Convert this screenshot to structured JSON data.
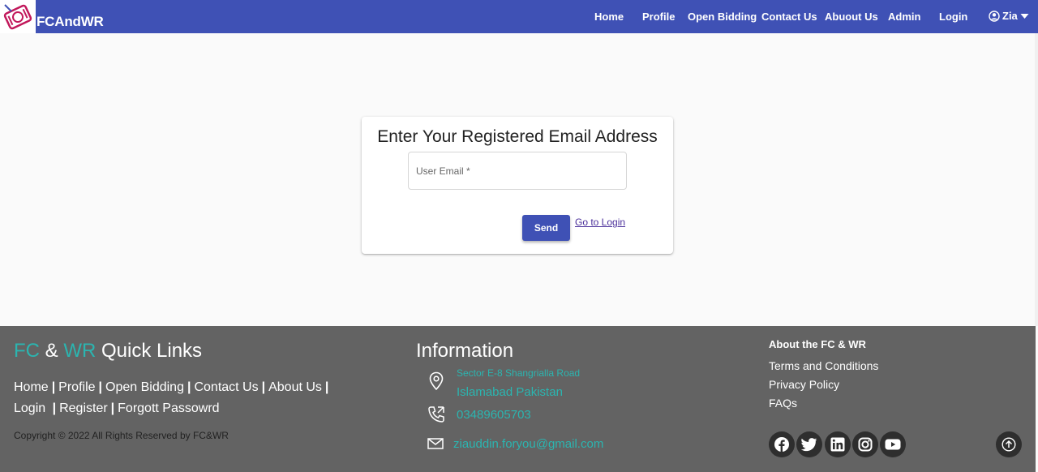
{
  "navbar": {
    "brand": "FCAndWR",
    "items": [
      {
        "label": "Home"
      },
      {
        "label": "Profile"
      },
      {
        "label": "Open Bidding"
      },
      {
        "label": "Contact Us"
      },
      {
        "label": "Abuout Us"
      },
      {
        "label": "Admin"
      },
      {
        "label": "Login"
      }
    ],
    "user": {
      "name": "Zia",
      "icon": "user-circle-icon"
    },
    "color": "#3f51b5"
  },
  "form": {
    "title": "Enter Your Registered Email Address",
    "email_placeholder": "User Email *",
    "email_value": "",
    "send_label": "Send",
    "login_link": "Go to Login"
  },
  "footer": {
    "quick_links": {
      "title_fc": "FC",
      "title_amp": "&",
      "title_wr": "WR",
      "title_rest": "Quick Links",
      "row1": [
        "Home",
        "Profile",
        "Open Bidding",
        "Contact Us",
        "About Us"
      ],
      "row2": [
        "Login",
        "Register",
        "Forgott Passowrd"
      ],
      "separator": "|",
      "copyright": "Copyright © 2022 All Rights Reserved by FC&WR"
    },
    "information": {
      "title": "Information",
      "address_line1": "Sector E-8 Shangrialla Road",
      "address_line2": "Islamabad Pakistan",
      "phone": "03489605703",
      "email": "ziauddin.foryou@gmail.com"
    },
    "about": {
      "title": "About the FC & WR",
      "links": [
        "Terms and Conditions",
        "Privacy Policy",
        "FAQs"
      ]
    },
    "social": [
      "facebook-icon",
      "twitter-icon",
      "linkedin-icon",
      "instagram-icon",
      "youtube-icon"
    ],
    "accent_color": "#2bb5b0",
    "background": "#636363"
  }
}
